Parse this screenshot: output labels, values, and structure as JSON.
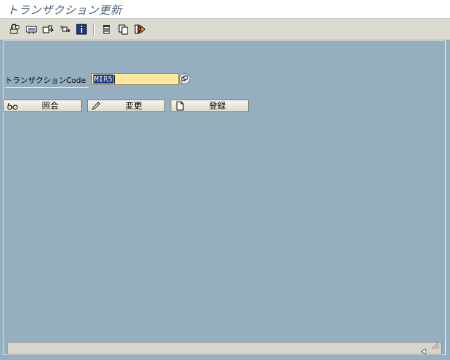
{
  "window": {
    "title": "トランザクション更新"
  },
  "toolbar": {
    "buttons": [
      {
        "icon": "display-change-icon"
      },
      {
        "icon": "choose-icon"
      },
      {
        "icon": "other-object-icon"
      },
      {
        "icon": "list-icon"
      },
      {
        "icon": "info-icon"
      },
      {
        "icon": "delete-icon"
      },
      {
        "icon": "copy-icon"
      },
      {
        "icon": "execute-icon"
      }
    ]
  },
  "form": {
    "transaction_label": "トランザクションCode",
    "transaction_value": "MIR5"
  },
  "actions": {
    "display_label": "照会",
    "change_label": "変更",
    "create_label": "登録"
  },
  "colors": {
    "background": "#95afc0",
    "input_bg": "#fde89a",
    "title_text": "#4d5f7c"
  }
}
